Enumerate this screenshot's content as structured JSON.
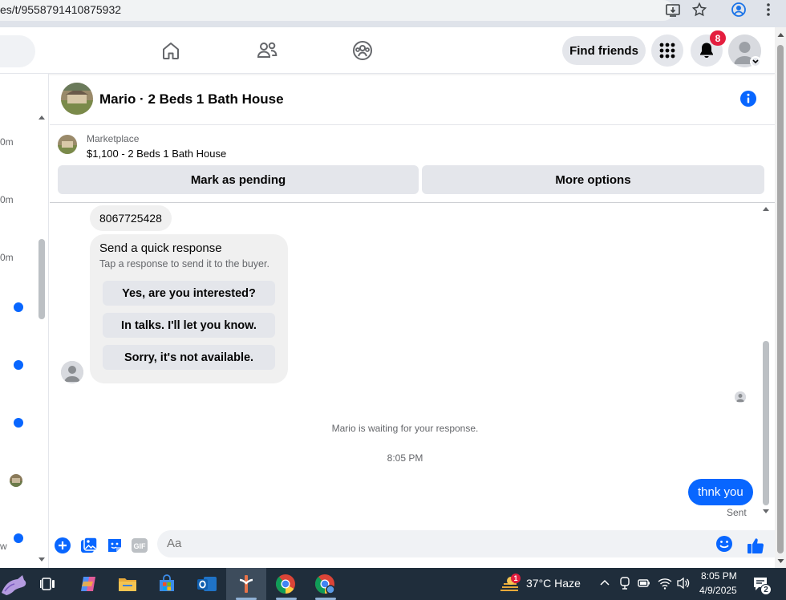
{
  "browser": {
    "url": "es/t/9558791410875932"
  },
  "header": {
    "find_friends_label": "Find friends",
    "notification_count": "8"
  },
  "sidebar": {
    "times": [
      "0m",
      "0m",
      "0m"
    ],
    "bottom_label": "w"
  },
  "conversation": {
    "title": "Mario · 2 Beds 1 Bath House"
  },
  "marketplace": {
    "label": "Marketplace",
    "listing": "$1,100 - 2 Beds 1 Bath House",
    "mark_pending_label": "Mark as pending",
    "more_options_label": "More options"
  },
  "messages": {
    "phone": "8067725428",
    "quick_title": "Send a quick response",
    "quick_subtitle": "Tap a response to send it to the buyer.",
    "quick_replies": [
      "Yes, are you interested?",
      "In talks. I'll let you know.",
      "Sorry, it's not available."
    ],
    "waiting_text": "Mario is waiting for your response.",
    "timestamp": "8:05 PM",
    "my_message": "thnk you",
    "status": "Sent"
  },
  "composer": {
    "placeholder": "Aa"
  },
  "taskbar": {
    "weather_badge": "1",
    "weather": "37°C  Haze",
    "time": "8:05 PM",
    "date": "4/9/2025",
    "notification_count": "2"
  },
  "colors": {
    "accent": "#0866ff",
    "badge": "#e41e3f",
    "taskbar": "#1f2d3b"
  }
}
